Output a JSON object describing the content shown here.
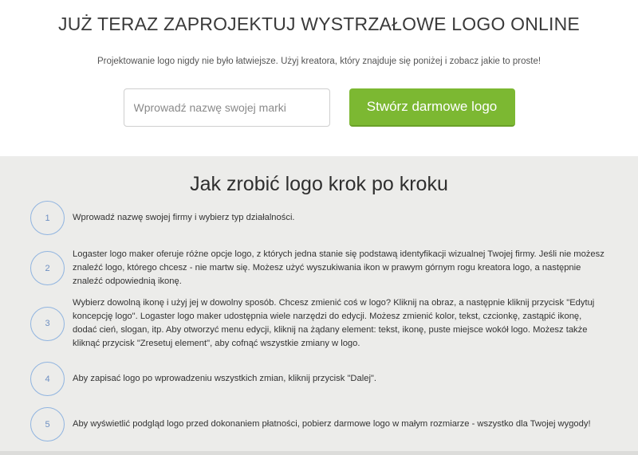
{
  "hero": {
    "title": "JUŻ TERAZ ZAPROJEKTUJ WYSTRZAŁOWE LOGO ONLINE",
    "subtitle": "Projektowanie logo nigdy nie było łatwiejsze. Użyj kreatora, który znajduje się poniżej i zobacz jakie to proste!",
    "input_placeholder": "Wprowadź nazwę swojej marki",
    "input_value": "",
    "button_label": "Stwórz darmowe logo"
  },
  "steps": {
    "title": "Jak zrobić logo krok po kroku",
    "items": [
      {
        "num": "1",
        "text": "Wprowadź nazwę swojej firmy i wybierz typ działalności."
      },
      {
        "num": "2",
        "text": "Logaster logo maker oferuje różne opcje logo, z których jedna stanie się podstawą identyfikacji wizualnej Twojej firmy. Jeśli nie możesz znaleźć logo, którego chcesz - nie martw się. Możesz użyć wyszukiwania ikon w prawym górnym rogu kreatora logo, a następnie znaleźć odpowiednią ikonę."
      },
      {
        "num": "3",
        "text": "Wybierz dowolną ikonę i użyj jej w dowolny sposób. Chcesz zmienić coś w logo? Kliknij na obraz, a następnie kliknij przycisk \"Edytuj koncepcję logo\". Logaster logo maker udostępnia wiele narzędzi do edycji. Możesz zmienić kolor, tekst, czcionkę, zastąpić ikonę, dodać cień, slogan, itp. Aby otworzyć menu edycji, kliknij na żądany element: tekst, ikonę, puste miejsce wokół logo. Możesz także kliknąć przycisk \"Zresetuj element\", aby cofnąć wszystkie zmiany w logo."
      },
      {
        "num": "4",
        "text": "Aby zapisać logo po wprowadzeniu wszystkich zmian, kliknij przycisk \"Dalej\"."
      },
      {
        "num": "5",
        "text": "Aby wyświetlić podgląd logo przed dokonaniem płatności, pobierz darmowe logo w małym rozmiarze - wszystko dla Twojej wygody!"
      }
    ]
  },
  "colors": {
    "accent_green": "#7cb832",
    "circle_blue": "#90b4e0",
    "section_bg": "#ececea"
  }
}
